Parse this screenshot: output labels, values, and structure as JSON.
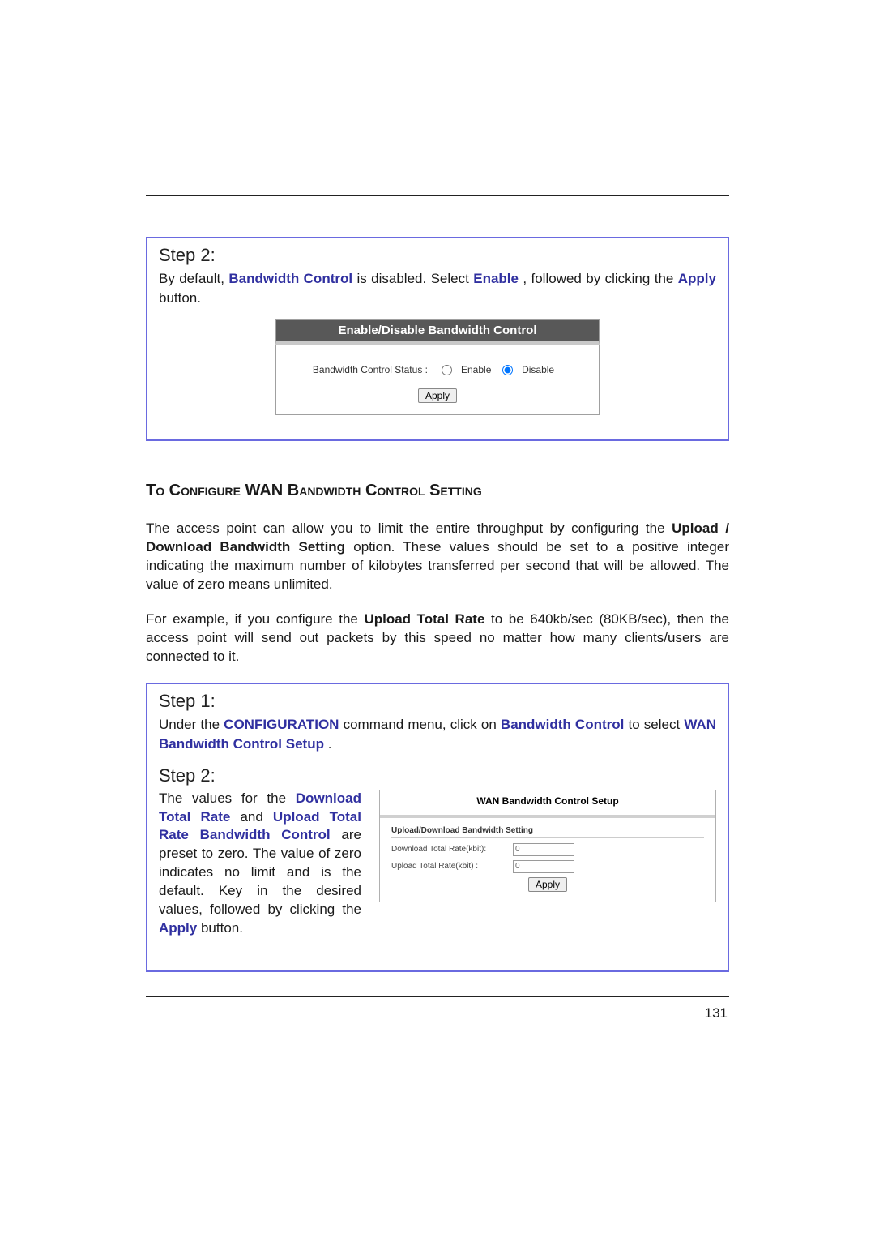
{
  "page_number": "131",
  "box1": {
    "step_title": "Step 2:",
    "body_prefix": "By default, ",
    "body_bold1": "Bandwidth Control",
    "body_mid": " is disabled. Select ",
    "body_bold2": "Enable",
    "body_suffix1": ", followed by clicking the ",
    "body_bold3": "Apply",
    "body_suffix2": " button."
  },
  "panel1": {
    "title": "Enable/Disable Bandwidth Control",
    "status_label": "Bandwidth Control Status :",
    "opt_enable": "Enable",
    "opt_disable": "Disable",
    "apply_label": "Apply"
  },
  "section_heading": "To Configure WAN Bandwidth Control Setting",
  "para1": {
    "t0": "The access point can allow you to limit the entire  throughput by configuring the ",
    "b0": "Upload / Download Bandwidth Setting",
    "t1": " option. These values should be set to a positive integer indicating the maximum number of kilobytes transferred per second that will be allowed.  The value of zero means unlimited."
  },
  "para2": {
    "t0": "For example, if you configure the ",
    "b0": "Upload Total Rate",
    "t1": " to be 640kb/sec (80KB/sec), then the access point will send out packets by this speed no matter how many clients/users are connected to it."
  },
  "box2": {
    "step1_title": "Step 1:",
    "step1_t0": "Under the ",
    "step1_b0": "CONFIGURATION",
    "step1_t1": " command menu, click on ",
    "step1_b1": "Bandwidth Control",
    "step1_t2": " to select ",
    "step1_b2": "WAN Bandwidth Control Setup",
    "step1_t3": ".",
    "step2_title": "Step 2:",
    "col_t0": "The values for the ",
    "col_b0": "Download Total Rate",
    "col_t1": " and ",
    "col_b1": "Upload Total Rate Bandwidth Control",
    "col_t2": " are preset to zero. The value of zero indicates no limit and is the default. Key in the desired values, followed by clicking the ",
    "col_b2": "Apply",
    "col_t3": " button."
  },
  "wan_panel": {
    "title": "WAN Bandwidth Control Setup",
    "subhead": "Upload/Download Bandwidth Setting",
    "download_label": "Download Total Rate(kbit):",
    "upload_label": "Upload Total Rate(kbit) :",
    "download_value": "0",
    "upload_value": "0",
    "apply_label": "Apply"
  }
}
